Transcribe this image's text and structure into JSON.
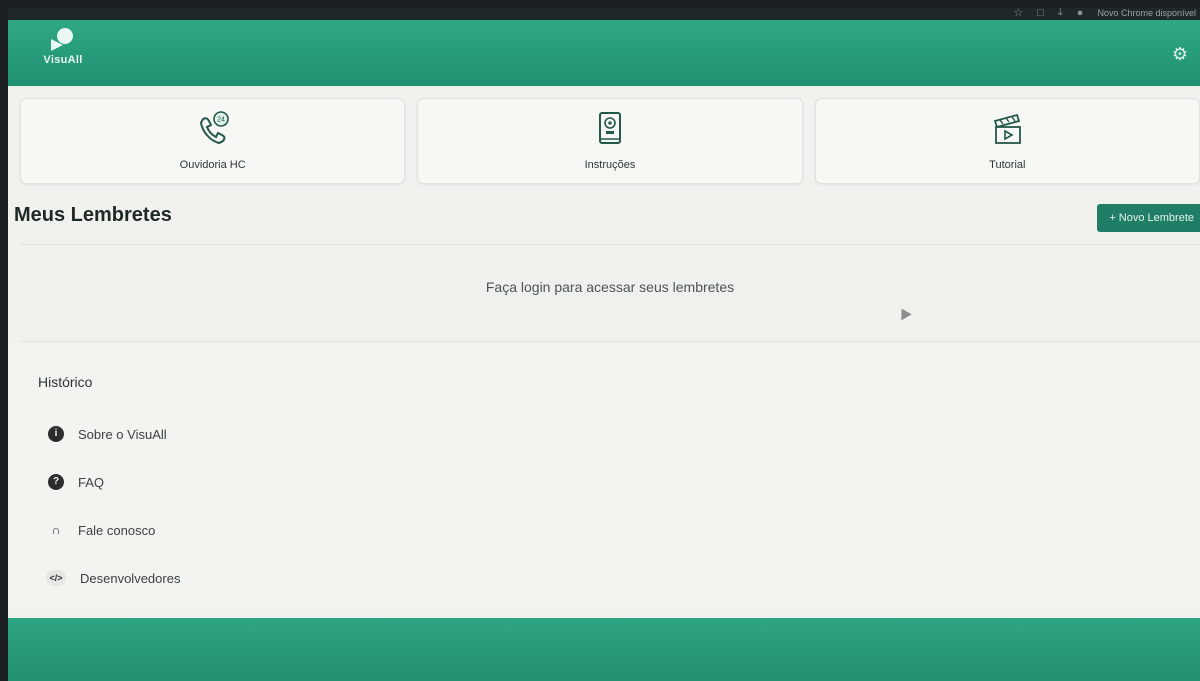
{
  "browser": {
    "top_right_text": "Novo Chrome disponível"
  },
  "header": {
    "logo_text": "VisuAll",
    "settings_icon": "gear-icon"
  },
  "cards": [
    {
      "label": "Ouvidoria HC",
      "icon": "phone-24h-icon"
    },
    {
      "label": "Instruções",
      "icon": "book-icon"
    },
    {
      "label": "Tutorial",
      "icon": "clapperboard-icon"
    }
  ],
  "reminders": {
    "title": "Meus Lembretes",
    "new_button": "+ Novo Lembrete",
    "login_message": "Faça login para acessar seus lembretes"
  },
  "history": {
    "title": "Histórico",
    "items": [
      {
        "label": "Sobre o VisuAll",
        "icon": "info-icon"
      },
      {
        "label": "FAQ",
        "icon": "question-icon"
      },
      {
        "label": "Fale conosco",
        "icon": "headphones-icon"
      },
      {
        "label": "Desenvolvedores",
        "icon": "code-icon"
      }
    ]
  },
  "colors": {
    "accent": "#219171",
    "button": "#1f7e65"
  }
}
